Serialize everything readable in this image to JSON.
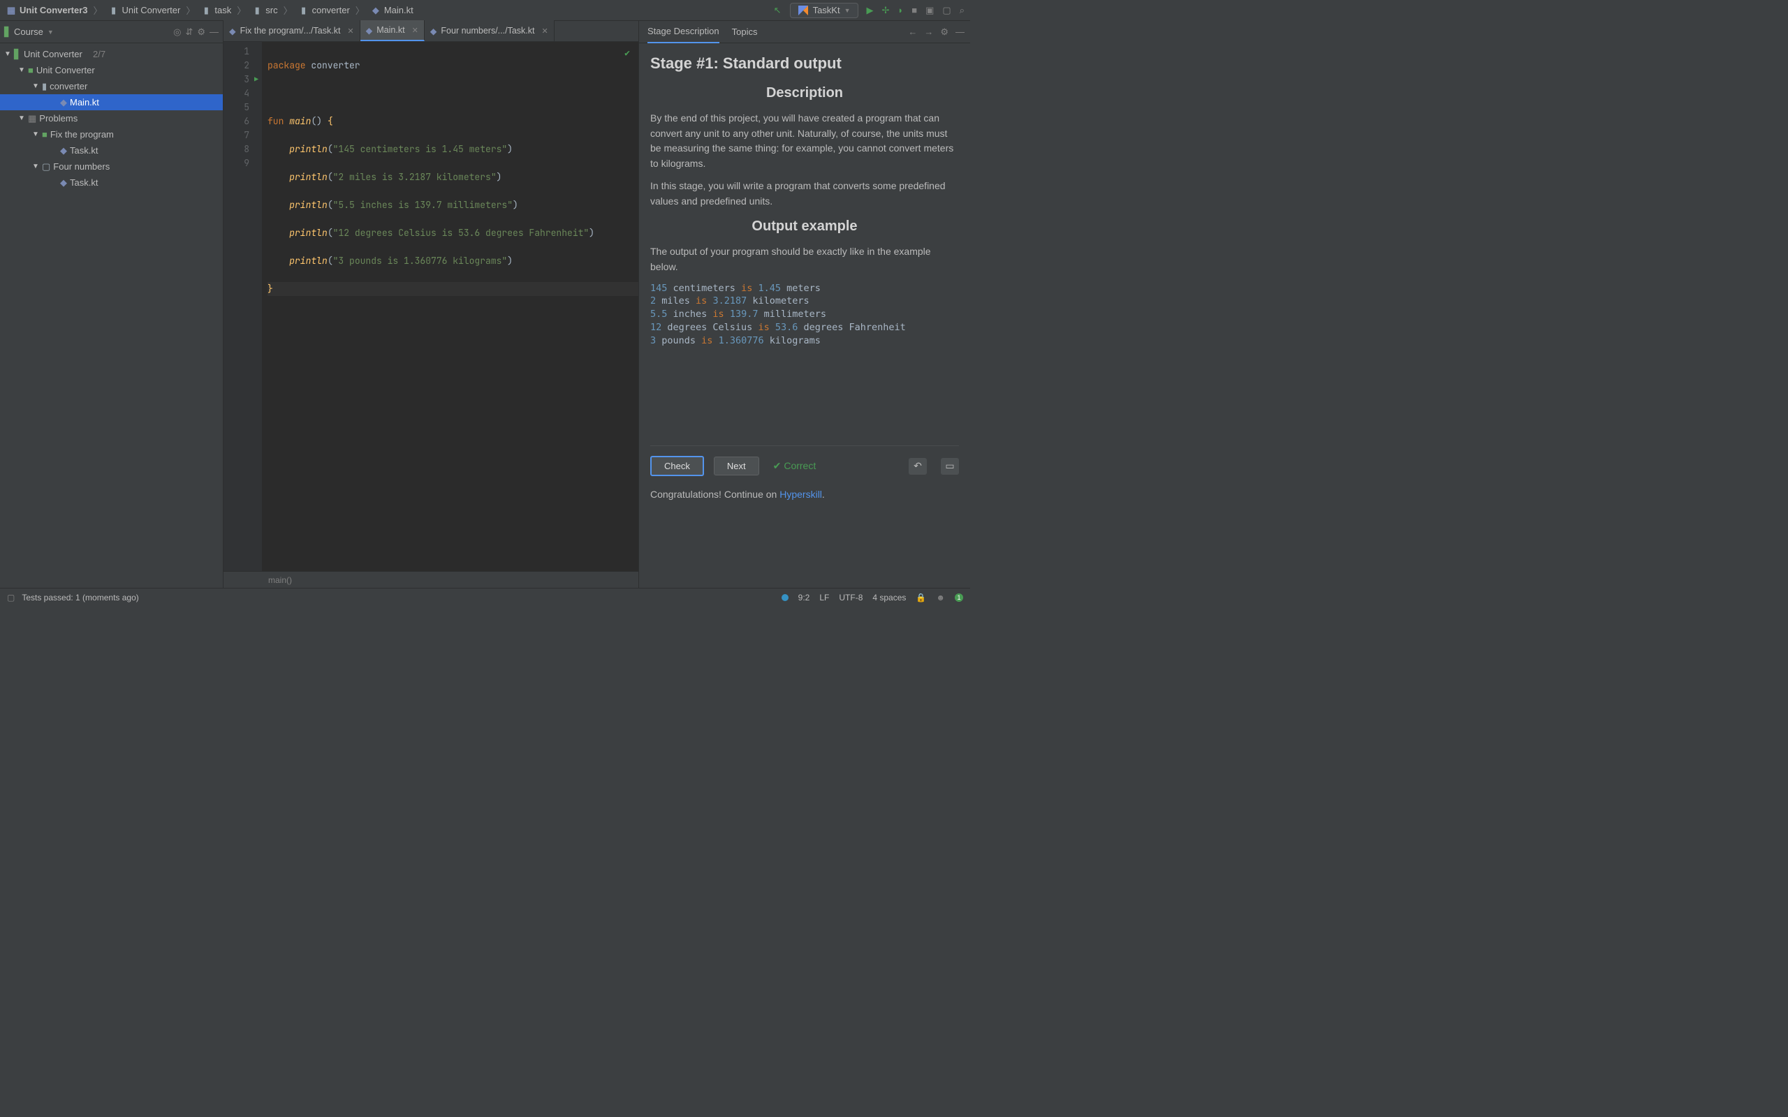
{
  "breadcrumbs": [
    {
      "label": "Unit Converter3",
      "bold": true
    },
    {
      "label": "Unit Converter"
    },
    {
      "label": "task"
    },
    {
      "label": "src"
    },
    {
      "label": "converter"
    },
    {
      "label": "Main.kt"
    }
  ],
  "runConfig": "TaskKt",
  "courseHeader": "Course",
  "tree": {
    "row0": {
      "label": "Unit Converter",
      "count": "2/7"
    },
    "row1": {
      "label": "Unit Converter"
    },
    "row2": {
      "label": "converter"
    },
    "row3": {
      "label": "Main.kt"
    },
    "row4": {
      "label": "Problems"
    },
    "row5": {
      "label": "Fix the program"
    },
    "row6": {
      "label": "Task.kt"
    },
    "row7": {
      "label": "Four numbers"
    },
    "row8": {
      "label": "Task.kt"
    }
  },
  "editorTabs": [
    {
      "label": "Fix the program/.../Task.kt"
    },
    {
      "label": "Main.kt"
    },
    {
      "label": "Four numbers/.../Task.kt"
    }
  ],
  "code": {
    "l1_pkg": "package",
    "l1_name": " converter",
    "l3_fun": "fun",
    "l3_main": " main",
    "l3_par": "() ",
    "l3_brace": "{",
    "l4_call": "println",
    "l4_open": "(",
    "l4_str": "\"145 centimeters is 1.45 meters\"",
    "l4_close": ")",
    "l5_call": "println",
    "l5_open": "(",
    "l5_str": "\"2 miles is 3.2187 kilometers\"",
    "l5_close": ")",
    "l6_call": "println",
    "l6_open": "(",
    "l6_str": "\"5.5 inches is 139.7 millimeters\"",
    "l6_close": ")",
    "l7_call": "println",
    "l7_open": "(",
    "l7_str": "\"12 degrees Celsius is 53.6 degrees Fahrenheit\"",
    "l7_close": ")",
    "l8_call": "println",
    "l8_open": "(",
    "l8_str": "\"3 pounds is 1.360776 kilograms\"",
    "l8_close": ")",
    "l9_brace": "}"
  },
  "lineNumbers": [
    "1",
    "2",
    "3",
    "4",
    "5",
    "6",
    "7",
    "8",
    "9"
  ],
  "editorFooter": "main()",
  "rightPanel": {
    "tabs": {
      "desc": "Stage Description",
      "topics": "Topics"
    },
    "title": "Stage #1: Standard output",
    "h_desc": "Description",
    "p1": "By the end of this project, you will have created a program that can convert any unit to any other unit. Naturally, of course, the units must be measuring the same thing: for example, you cannot convert meters to kilograms.",
    "p2": "In this stage, you will write a program that converts some predefined values and predefined units.",
    "h_out": "Output example",
    "p3": "The output of your program should be exactly like in the example below.",
    "example": [
      {
        "n": "145",
        "t": " centimeters ",
        "is": "is",
        "n2": " 1.45",
        "t2": " meters"
      },
      {
        "n": "2",
        "t": " miles ",
        "is": "is",
        "n2": " 3.2187",
        "t2": " kilometers"
      },
      {
        "n": "5.5",
        "t": " inches ",
        "is": "is",
        "n2": " 139.7",
        "t2": " millimeters"
      },
      {
        "n": "12",
        "t": " degrees Celsius ",
        "is": "is",
        "n2": " 53.6",
        "t2": " degrees Fahrenheit"
      },
      {
        "n": "3",
        "t": " pounds ",
        "is": "is",
        "n2": " 1.360776",
        "t2": " kilograms"
      }
    ],
    "checkBtn": "Check",
    "nextBtn": "Next",
    "correct": "Correct",
    "congrats_a": "Congratulations! Continue on ",
    "congrats_link": "Hyperskill",
    "congrats_b": "."
  },
  "status": {
    "tests": "Tests passed: 1 (moments ago)",
    "pos": "9:2",
    "lf": "LF",
    "enc": "UTF-8",
    "indent": "4 spaces",
    "badge": "1"
  }
}
